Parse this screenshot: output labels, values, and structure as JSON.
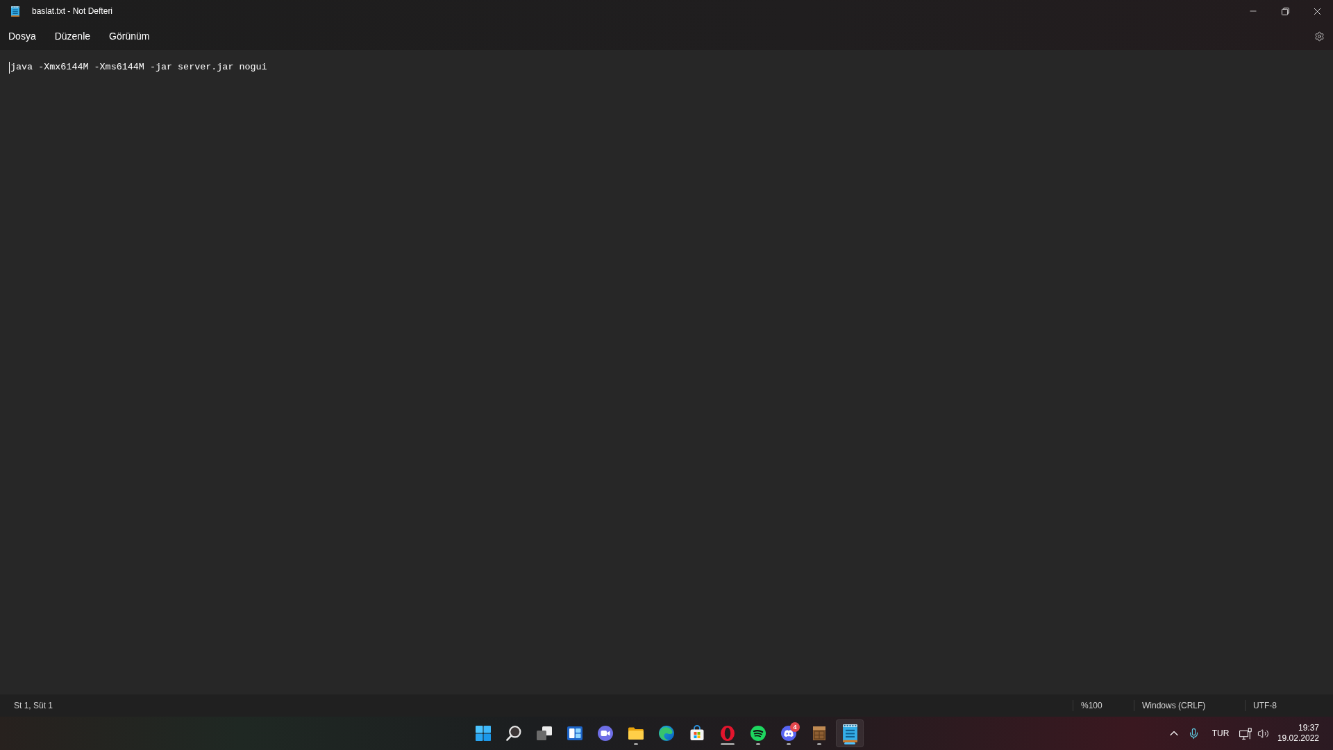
{
  "window": {
    "title": "baslat.txt - Not Defteri"
  },
  "menu": [
    {
      "label": "Dosya"
    },
    {
      "label": "Düzenle"
    },
    {
      "label": "Görünüm"
    }
  ],
  "editor": {
    "lines": [
      "java -Xmx6144M -Xms6144M -jar server.jar nogui"
    ]
  },
  "status_bar": {
    "position": "St 1, Süt 1",
    "zoom": "%100",
    "line_ending": "Windows (CRLF)",
    "encoding": "UTF-8"
  },
  "taskbar": {
    "apps": [
      {
        "kind": "start",
        "running": false,
        "selected": false
      },
      {
        "kind": "search",
        "running": false,
        "selected": false
      },
      {
        "kind": "taskview",
        "running": false,
        "selected": false
      },
      {
        "kind": "widgets",
        "running": false,
        "selected": false
      },
      {
        "kind": "chat",
        "running": false,
        "selected": false
      },
      {
        "kind": "explorer",
        "running": true,
        "indicator_wide": false,
        "selected": false
      },
      {
        "kind": "edge",
        "running": false,
        "selected": false
      },
      {
        "kind": "store",
        "running": false,
        "selected": false
      },
      {
        "kind": "opera",
        "running": true,
        "indicator_wide": true,
        "selected": false
      },
      {
        "kind": "spotify",
        "running": true,
        "indicator_wide": false,
        "selected": false
      },
      {
        "kind": "discord",
        "running": true,
        "indicator_wide": false,
        "selected": false,
        "badge": "4"
      },
      {
        "kind": "minecraft",
        "running": true,
        "indicator_wide": false,
        "selected": false
      },
      {
        "kind": "notepad",
        "running": true,
        "indicator_wide": true,
        "selected": true
      }
    ],
    "tray": {
      "language": "TUR",
      "time": "19:37",
      "date": "19.02.2022"
    }
  }
}
